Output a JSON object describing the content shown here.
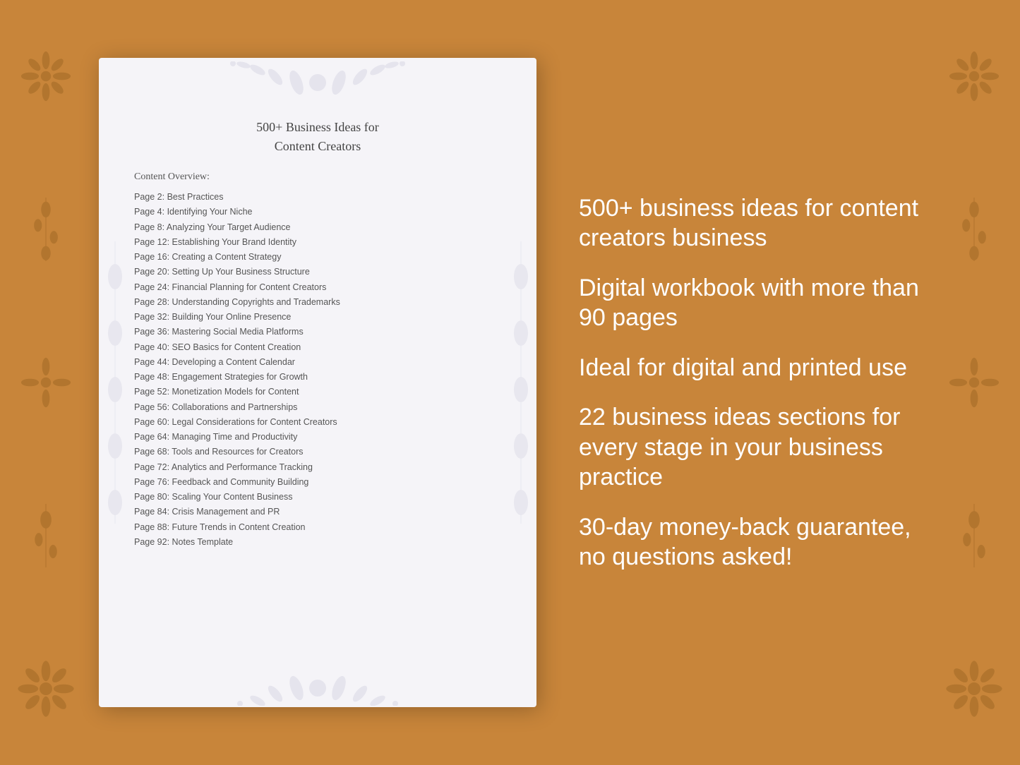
{
  "document": {
    "title_line1": "500+ Business Ideas for",
    "title_line2": "Content Creators",
    "section_label": "Content Overview:",
    "toc_items": [
      {
        "page": "Page  2:",
        "title": "Best Practices"
      },
      {
        "page": "Page  4:",
        "title": "Identifying Your Niche"
      },
      {
        "page": "Page  8:",
        "title": "Analyzing Your Target Audience"
      },
      {
        "page": "Page 12:",
        "title": "Establishing Your Brand Identity"
      },
      {
        "page": "Page 16:",
        "title": "Creating a Content Strategy"
      },
      {
        "page": "Page 20:",
        "title": "Setting Up Your Business Structure"
      },
      {
        "page": "Page 24:",
        "title": "Financial Planning for Content Creators"
      },
      {
        "page": "Page 28:",
        "title": "Understanding Copyrights and Trademarks"
      },
      {
        "page": "Page 32:",
        "title": "Building Your Online Presence"
      },
      {
        "page": "Page 36:",
        "title": "Mastering Social Media Platforms"
      },
      {
        "page": "Page 40:",
        "title": "SEO Basics for Content Creation"
      },
      {
        "page": "Page 44:",
        "title": "Developing a Content Calendar"
      },
      {
        "page": "Page 48:",
        "title": "Engagement Strategies for Growth"
      },
      {
        "page": "Page 52:",
        "title": "Monetization Models for Content"
      },
      {
        "page": "Page 56:",
        "title": "Collaborations and Partnerships"
      },
      {
        "page": "Page 60:",
        "title": "Legal Considerations for Content Creators"
      },
      {
        "page": "Page 64:",
        "title": "Managing Time and Productivity"
      },
      {
        "page": "Page 68:",
        "title": "Tools and Resources for Creators"
      },
      {
        "page": "Page 72:",
        "title": "Analytics and Performance Tracking"
      },
      {
        "page": "Page 76:",
        "title": "Feedback and Community Building"
      },
      {
        "page": "Page 80:",
        "title": "Scaling Your Content Business"
      },
      {
        "page": "Page 84:",
        "title": "Crisis Management and PR"
      },
      {
        "page": "Page 88:",
        "title": "Future Trends in Content Creation"
      },
      {
        "page": "Page 92:",
        "title": "Notes Template"
      }
    ]
  },
  "features": [
    "500+ business ideas for content creators business",
    "Digital workbook with more than 90 pages",
    "Ideal for digital and printed use",
    "22 business ideas sections for every stage in your business practice",
    "30-day money-back guarantee, no questions asked!"
  ]
}
